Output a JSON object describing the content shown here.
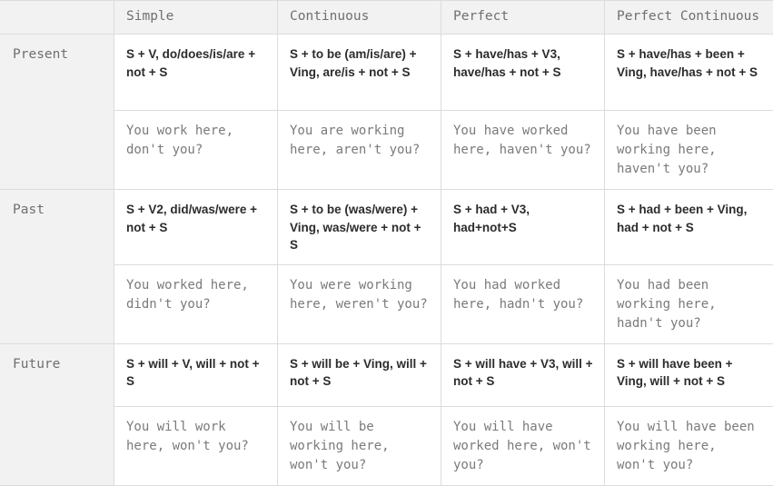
{
  "table": {
    "corner_label": "",
    "columns": [
      "Simple",
      "Continuous",
      "Perfect",
      "Perfect Continuous"
    ],
    "rows": [
      {
        "tense": "Present",
        "formulas": [
          "S + V, do/does/is/are + not + S",
          "S + to be (am/is/are) + Ving, are/is + not + S",
          "S + have/has + V3, have/has + not + S",
          "S + have/has + been + Ving, have/has + not + S"
        ],
        "examples": [
          "You work here, don't you?",
          "You are working here, aren't you?",
          "You have worked here, haven't you?",
          "You have been working here, haven't you?"
        ]
      },
      {
        "tense": "Past",
        "formulas": [
          "S + V2, did/was/were + not + S",
          "S + to be (was/were) + Ving, was/were + not + S",
          "S + had + V3, had+not+S",
          "S + had + been + Ving, had + not + S"
        ],
        "examples": [
          "You worked here, didn't you?",
          "You were working here, weren't you?",
          "You had worked here, hadn't you?",
          "You had been working here, hadn't you?"
        ]
      },
      {
        "tense": "Future",
        "formulas": [
          "S + will + V, will + not + S",
          "S + will be + Ving, will + not + S",
          "S + will have + V3, will + not + S",
          "S + will have been + Ving, will + not + S"
        ],
        "examples": [
          "You will work here, won't you?",
          "You will be working here, won't you?",
          "You will have worked here, won't you?",
          "You will have been working here, won't you?"
        ]
      }
    ]
  },
  "colors": {
    "header_background": "#f2f2f2",
    "body_background": "#ffffff",
    "border": "#dcdcdc",
    "header_text": "#6f6f6f",
    "formula_text": "#2c2c2c",
    "example_text": "#7a7a7a"
  }
}
